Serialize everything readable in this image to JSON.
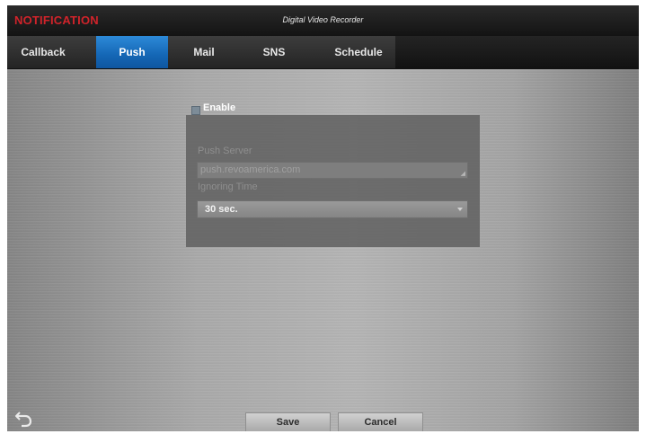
{
  "header": {
    "app_title": "NOTIFICATION",
    "window_title": "Digital Video Recorder"
  },
  "tabs": [
    {
      "label": "Callback",
      "active": false
    },
    {
      "label": "Push",
      "active": true
    },
    {
      "label": "Mail",
      "active": false
    },
    {
      "label": "SNS",
      "active": false
    },
    {
      "label": "Schedule",
      "active": false
    }
  ],
  "form": {
    "enable_label": "Enable",
    "enable_checked": false,
    "push_server_label": "Push Server",
    "push_server_value": "push.revoamerica.com",
    "ignoring_time_label": "Ignoring Time",
    "ignoring_time_value": "30 sec."
  },
  "footer": {
    "save_label": "Save",
    "cancel_label": "Cancel",
    "back_icon": "back-arrow-icon"
  },
  "colors": {
    "accent_tab": "#1a6fc0",
    "app_title": "#d0232a"
  }
}
